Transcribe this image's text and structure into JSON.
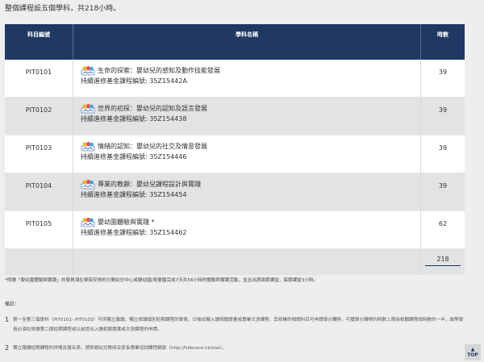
{
  "intro": "整個課程設五個學科，共218小時。",
  "table": {
    "headers": {
      "code": "科目編號",
      "subject": "學科名稱",
      "hours": "時數"
    },
    "rows": [
      {
        "code": "PIT0101",
        "title": "生命的探索：嬰幼兒的感知及動作技能發展",
        "ref": "持續進修基金課程編號: 35Z15442A",
        "hours": "39"
      },
      {
        "code": "PIT0102",
        "title": "世界的初探：嬰幼兒的認知及語言發展",
        "ref": "持續進修基金課程編號: 35Z154438",
        "hours": "39"
      },
      {
        "code": "PIT0103",
        "title": "情緒的認知：嬰幼兒的社交及情意發展",
        "ref": "持續進修基金課程編號: 35Z154446",
        "hours": "39"
      },
      {
        "code": "PIT0104",
        "title": "專業的教顧：嬰幼兒課程設計與實踐",
        "ref": "持續進修基金課程編號: 35Z154454",
        "hours": "39"
      },
      {
        "code": "PIT0105",
        "title": "嬰幼園體驗與實踐 *",
        "ref": "持續進修基金課程編號: 35Z154462",
        "hours": "62"
      }
    ],
    "total": "218"
  },
  "footnote": "*修讀「嬰幼園體驗與實踐」的學員須在學院安排的日間幼兒中心或嬰幼園/育嬰園完成7天共56小時的體驗與實踐活動，並且出席兩節課堂，每節課堂3小時。",
  "notes": {
    "label": "備註：",
    "items": [
      {
        "num": "1",
        "text": "第一至第三個學科（PIT0101- PIT0103）可供獨立報讀，獨立修讀個別短期課程的學員，日後如擬入讀相關證書或專業文憑課程，其修畢的相關科目可申請學分轉移，可獲學分轉移的時數上限為相關課程總時數的一半，該等學員必須在修讀第二個短期課程或以前提出入讀相關證書或文憑課程的申請。"
      },
      {
        "num": "2",
        "text": "獨立報讀短期課程的詳情及報名表，請參閱幼兒教研及家長專業培訓課程網頁（http://hkbusce.hk/ose）。"
      }
    ]
  },
  "top_button": "TOP",
  "colors": {
    "header_bg": "#1f3864",
    "row_alt": "#e3e3e3",
    "page_bg": "#eeeeee"
  },
  "icons": {
    "course": "course-badge-icon"
  }
}
